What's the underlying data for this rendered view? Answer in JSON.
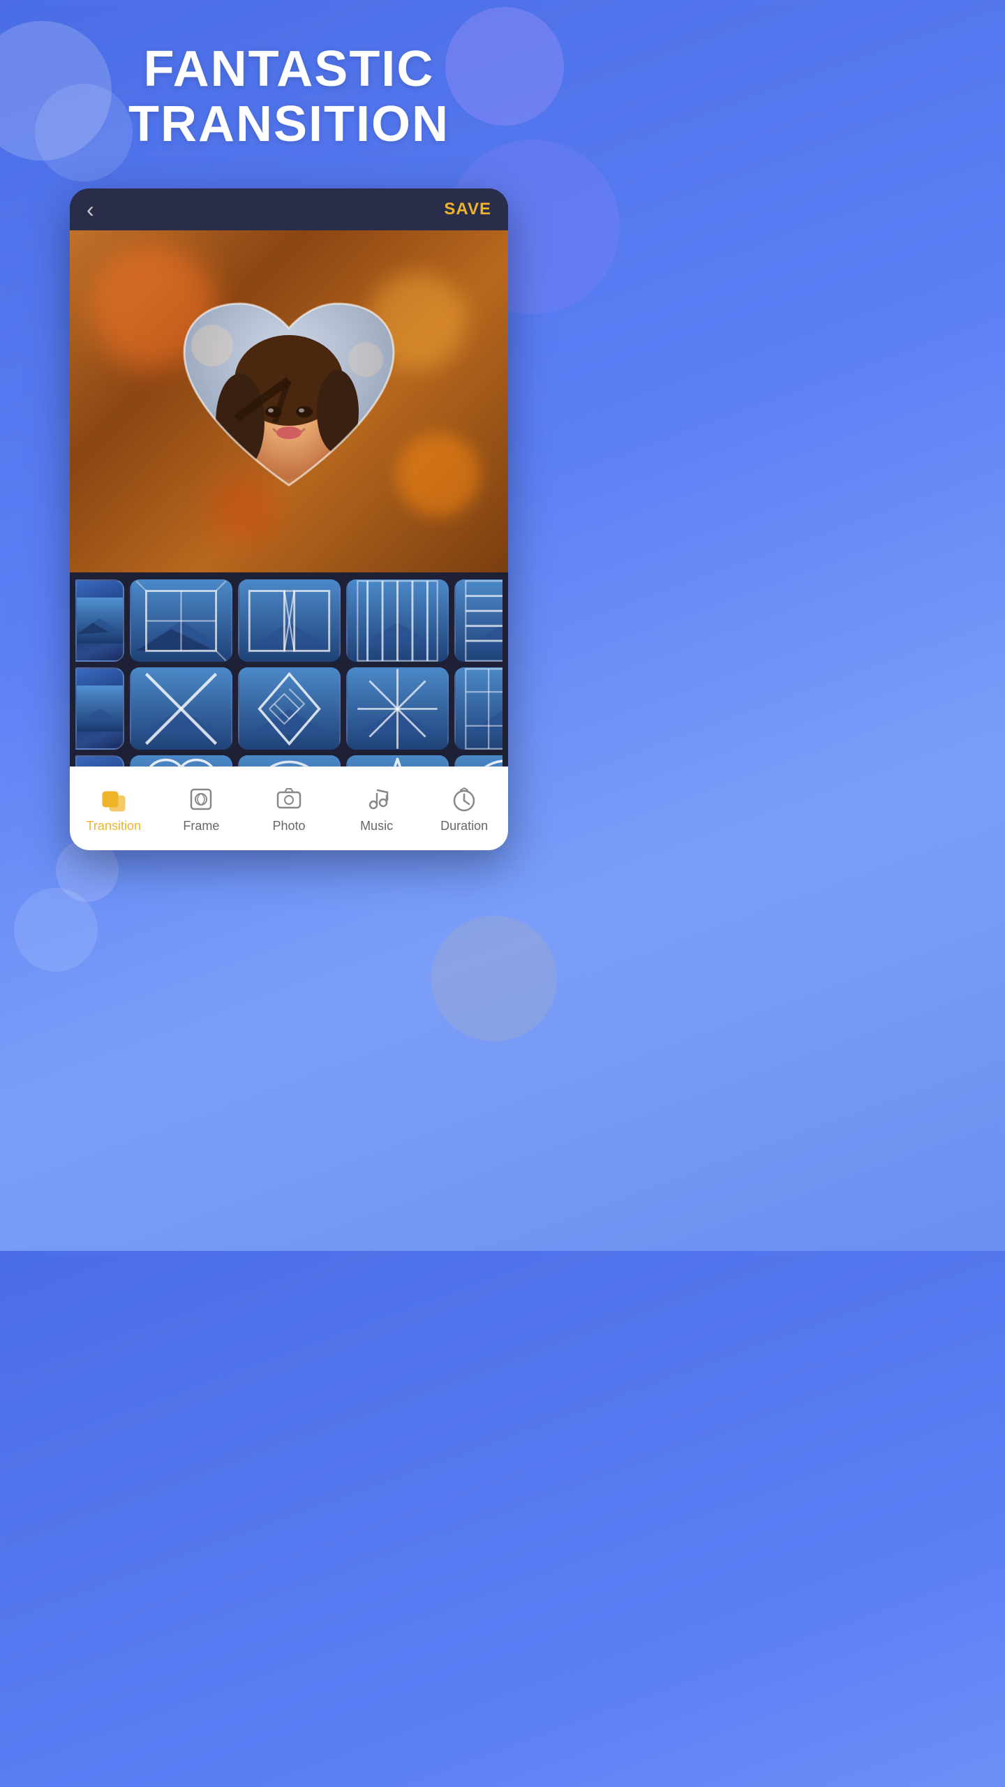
{
  "hero": {
    "title_line1": "FANTASTIC",
    "title_line2": "TRANSITION"
  },
  "topbar": {
    "back_label": "‹",
    "save_label": "SAVE"
  },
  "grid": {
    "rows": [
      [
        "cube",
        "book",
        "blinds",
        "stripes"
      ],
      [
        "cross",
        "diamond-reveal",
        "star",
        "mosaic"
      ],
      [
        "heart",
        "circle-expand",
        "star-wipe",
        "circle"
      ]
    ]
  },
  "nav": {
    "items": [
      {
        "id": "transition",
        "label": "Transition",
        "active": true
      },
      {
        "id": "frame",
        "label": "Frame",
        "active": false
      },
      {
        "id": "photo",
        "label": "Photo",
        "active": false
      },
      {
        "id": "music",
        "label": "Music",
        "active": false
      },
      {
        "id": "duration",
        "label": "Duration",
        "active": false
      }
    ]
  }
}
